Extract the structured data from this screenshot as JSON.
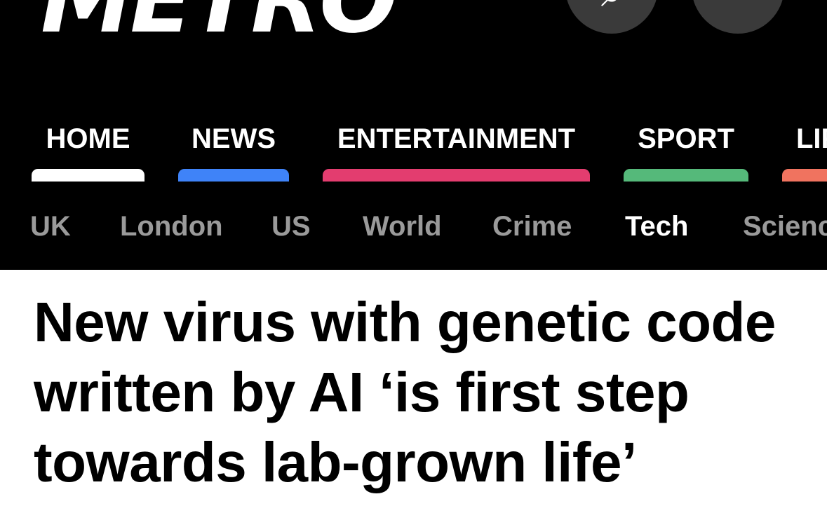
{
  "site": {
    "logo_text": "METRO"
  },
  "header_buttons": {
    "search_icon": "search-icon",
    "menu_icon": "menu-icon"
  },
  "main_nav": [
    {
      "label": "HOME",
      "color": "#ffffff"
    },
    {
      "label": "NEWS",
      "color": "#3f83f8"
    },
    {
      "label": "ENTERTAINMENT",
      "color": "#e33d6f"
    },
    {
      "label": "SPORT",
      "color": "#55b97a"
    },
    {
      "label": "LIFESTYLE",
      "color": "#f0735f"
    }
  ],
  "sub_nav": [
    {
      "label": "UK",
      "active": false
    },
    {
      "label": "London",
      "active": false
    },
    {
      "label": "US",
      "active": false
    },
    {
      "label": "World",
      "active": false
    },
    {
      "label": "Crime",
      "active": false
    },
    {
      "label": "Tech",
      "active": true
    },
    {
      "label": "Science",
      "active": false
    }
  ],
  "article": {
    "headline": "New virus with genetic code written by AI ‘is first step towards lab-grown life’"
  },
  "colors": {
    "header_bg": "#000000",
    "inactive_sub": "#9a9a9a",
    "active_sub": "#ffffff"
  }
}
